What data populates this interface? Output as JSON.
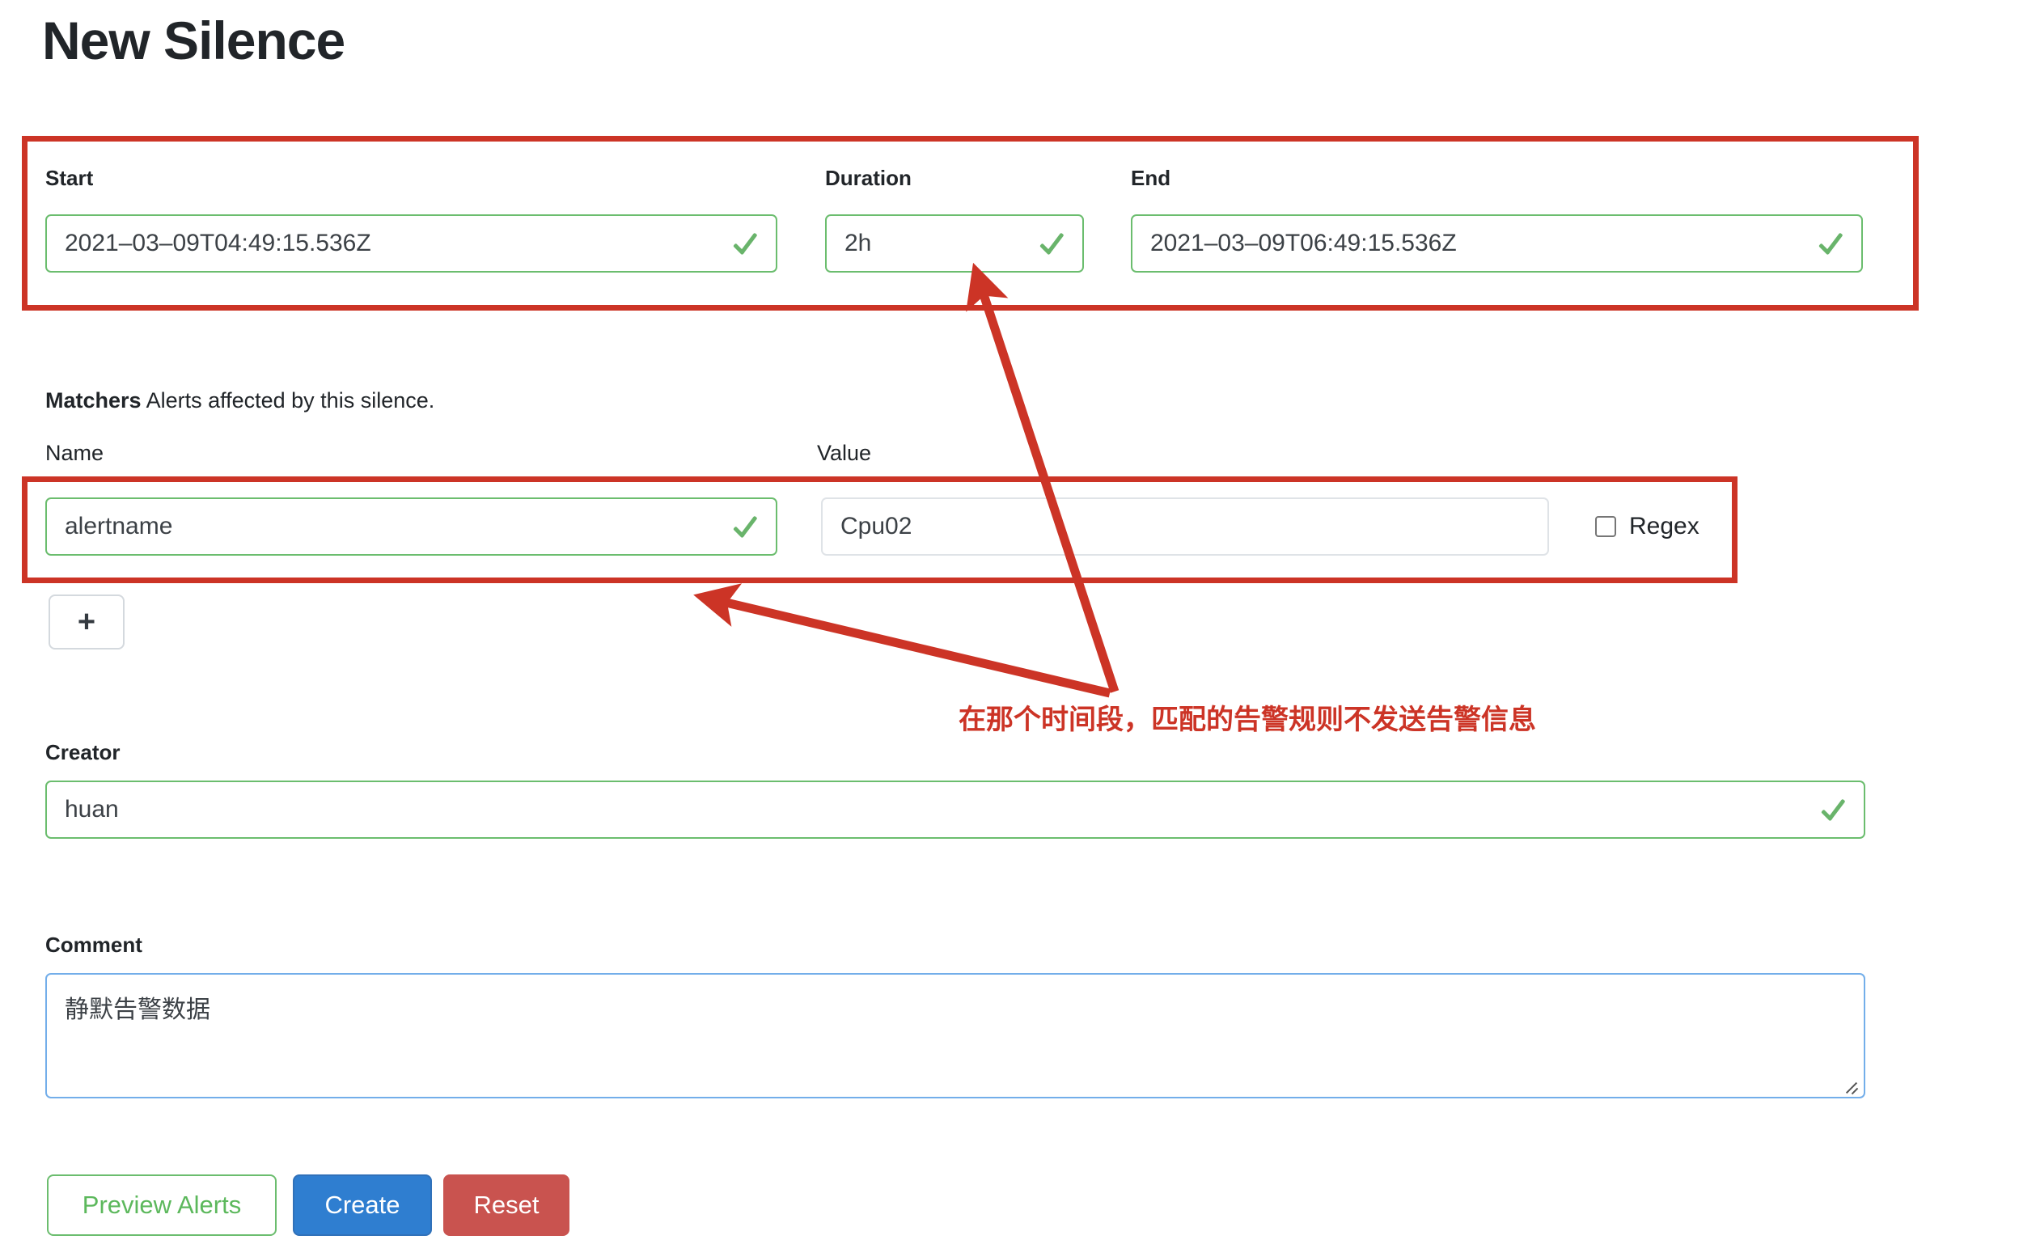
{
  "page": {
    "title": "New Silence"
  },
  "schedule": {
    "start_label": "Start",
    "start_value": "2021–03–09T04:49:15.536Z",
    "duration_label": "Duration",
    "duration_value": "2h",
    "end_label": "End",
    "end_value": "2021–03–09T06:49:15.536Z"
  },
  "matchers": {
    "heading_bold": "Matchers",
    "heading_rest": "Alerts affected by this silence.",
    "name_label": "Name",
    "value_label": "Value",
    "rows": [
      {
        "name": "alertname",
        "value": "Cpu02",
        "regex_label": "Regex",
        "regex_checked": false
      }
    ],
    "add_button_label": "+"
  },
  "creator": {
    "label": "Creator",
    "value": "huan"
  },
  "comment": {
    "label": "Comment",
    "value": "静默告警数据"
  },
  "actions": {
    "preview_label": "Preview Alerts",
    "create_label": "Create",
    "reset_label": "Reset"
  },
  "annotations": {
    "note_text": "在那个时间段，匹配的告警规则不发送告警信息",
    "color": "#cc3426"
  },
  "colors": {
    "valid_green": "#6bbd6e",
    "primary_blue": "#2f7ed0",
    "danger_red": "#c9534f",
    "annotation_red": "#cc3426",
    "textarea_border": "#73aeea"
  }
}
